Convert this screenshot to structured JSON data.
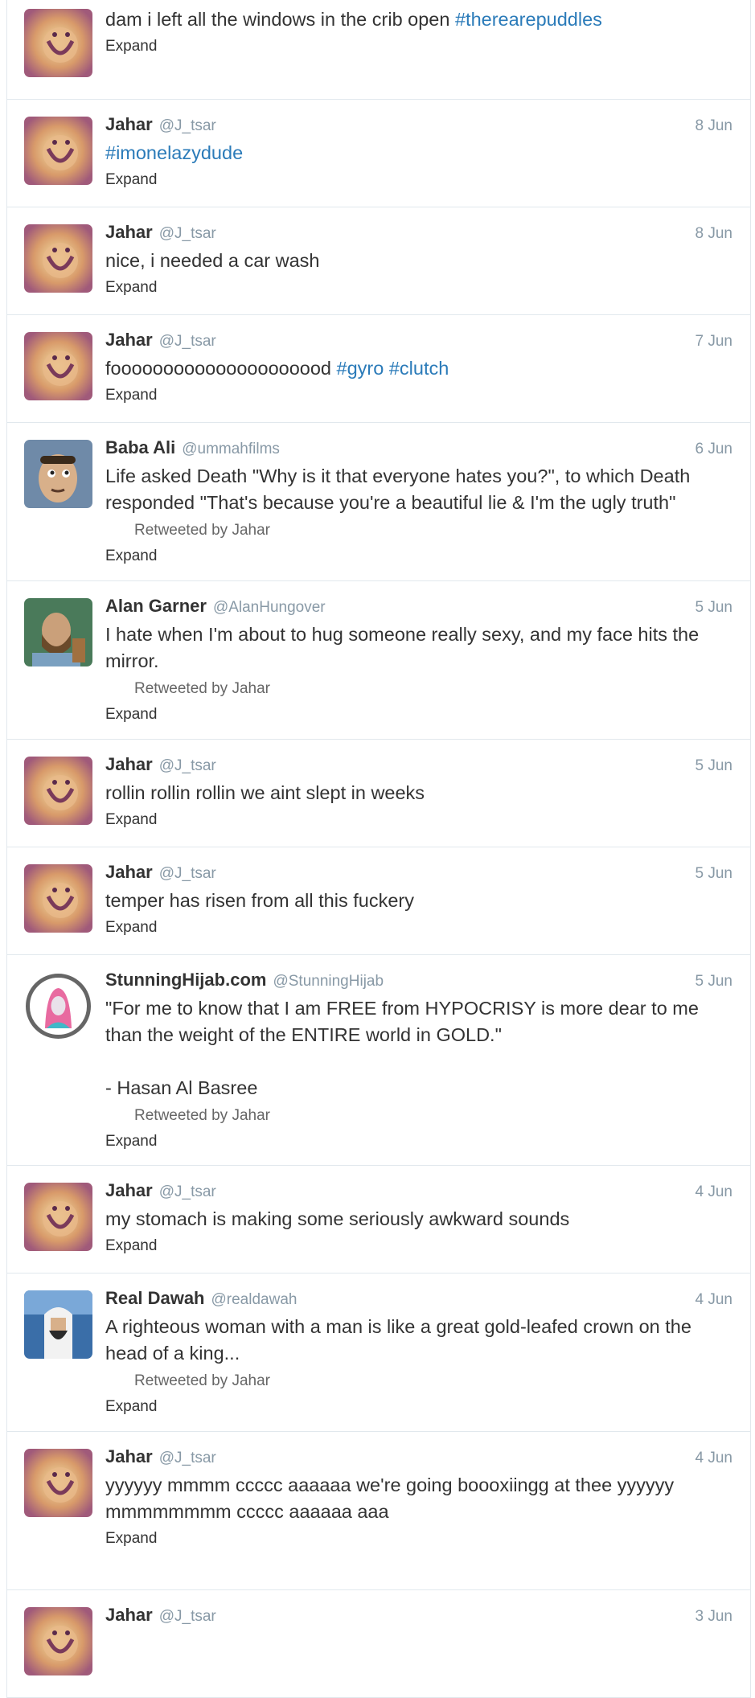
{
  "timeline": {
    "tweets": [
      {
        "id": "t0",
        "fullname": "",
        "username": "",
        "time": "",
        "text_before": "dam i left all the windows in the crib open ",
        "hashtags": [
          "#therearepuddles"
        ],
        "retweeted_by": "",
        "expand": "Expand",
        "avatar_icon": "jahar-avatar"
      },
      {
        "id": "t1",
        "fullname": "Jahar",
        "username": "@J_tsar",
        "time": "8 Jun",
        "text_before": "",
        "hashtags": [
          "#imonelazydude"
        ],
        "retweeted_by": "",
        "expand": "Expand",
        "avatar_icon": "jahar-avatar"
      },
      {
        "id": "t2",
        "fullname": "Jahar",
        "username": "@J_tsar",
        "time": "8 Jun",
        "text_before": "nice, i needed a car wash",
        "hashtags": [],
        "retweeted_by": "",
        "expand": "Expand",
        "avatar_icon": "jahar-avatar"
      },
      {
        "id": "t3",
        "fullname": "Jahar",
        "username": "@J_tsar",
        "time": "7 Jun",
        "text_before": "fooooooooooooooooooood ",
        "hashtags": [
          "#gyro",
          "#clutch"
        ],
        "retweeted_by": "",
        "expand": "Expand",
        "avatar_icon": "jahar-avatar"
      },
      {
        "id": "t4",
        "fullname": "Baba Ali",
        "username": "@ummahfilms",
        "time": "6 Jun",
        "text_before": "Life asked Death \"Why is it that everyone hates you?\", to which Death responded \"That's because you're a beautiful lie & I'm the ugly truth\"",
        "hashtags": [],
        "retweeted_by": "Retweeted by Jahar",
        "expand": "Expand",
        "avatar_icon": "baba-ali-avatar"
      },
      {
        "id": "t5",
        "fullname": "Alan Garner",
        "username": "@AlanHungover",
        "time": "5 Jun",
        "text_before": "I hate when I'm about to hug someone really sexy, and my face hits the mirror.",
        "hashtags": [],
        "retweeted_by": "Retweeted by Jahar",
        "expand": "Expand",
        "avatar_icon": "alan-garner-avatar"
      },
      {
        "id": "t6",
        "fullname": "Jahar",
        "username": "@J_tsar",
        "time": "5 Jun",
        "text_before": "rollin rollin rollin we aint slept in weeks",
        "hashtags": [],
        "retweeted_by": "",
        "expand": "Expand",
        "avatar_icon": "jahar-avatar"
      },
      {
        "id": "t7",
        "fullname": "Jahar",
        "username": "@J_tsar",
        "time": "5 Jun",
        "text_before": "temper has risen from all this fuckery",
        "hashtags": [],
        "retweeted_by": "",
        "expand": "Expand",
        "avatar_icon": "jahar-avatar"
      },
      {
        "id": "t8",
        "fullname": "StunningHijab.com",
        "username": "@StunningHijab",
        "time": "5 Jun",
        "text_before": "\"For me to know that I am FREE from HYPOCRISY is more dear to me than the weight of the ENTIRE world in GOLD.\"\n\n- Hasan Al Basree",
        "hashtags": [],
        "retweeted_by": "Retweeted by Jahar",
        "expand": "Expand",
        "avatar_icon": "stunning-hijab-avatar"
      },
      {
        "id": "t9",
        "fullname": "Jahar",
        "username": "@J_tsar",
        "time": "4 Jun",
        "text_before": "my stomach is making some seriously awkward sounds",
        "hashtags": [],
        "retweeted_by": "",
        "expand": "Expand",
        "avatar_icon": "jahar-avatar"
      },
      {
        "id": "t10",
        "fullname": "Real Dawah",
        "username": "@realdawah",
        "time": "4 Jun",
        "text_before": "A righteous woman with a man is like a great gold-leafed crown on the head of a king...",
        "hashtags": [],
        "retweeted_by": "Retweeted by Jahar",
        "expand": "Expand",
        "avatar_icon": "real-dawah-avatar"
      },
      {
        "id": "t11",
        "fullname": "Jahar",
        "username": "@J_tsar",
        "time": "4 Jun",
        "text_before": "yyyyyy mmmm ccccc aaaaaa we're going boooxiingg at thee yyyyyy mmmmmmmm ccccc aaaaaa aaa",
        "hashtags": [],
        "retweeted_by": "",
        "expand": "Expand",
        "avatar_icon": "jahar-avatar"
      },
      {
        "id": "t12",
        "fullname": "Jahar",
        "username": "@J_tsar",
        "time": "3 Jun",
        "text_before": "",
        "hashtags": [],
        "retweeted_by": "",
        "expand": "",
        "avatar_icon": "jahar-avatar"
      }
    ]
  },
  "colors": {
    "hashtag": "#2b7bb9",
    "secondary_text": "#8899a6",
    "border": "#e1e8ed",
    "primary_text": "#333333"
  }
}
